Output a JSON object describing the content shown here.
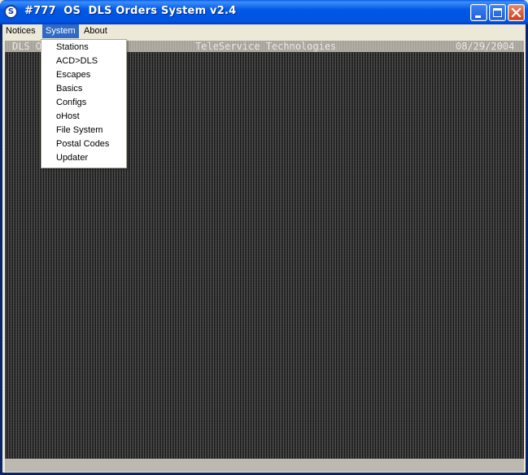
{
  "window": {
    "title": "#777  OS  DLS Orders System v2.4",
    "app_icon_letter": "S",
    "buttons": {
      "minimize": "minimize-icon",
      "maximize": "maximize-icon",
      "close": "close-icon"
    }
  },
  "menubar": {
    "items": [
      {
        "label": "Notices"
      },
      {
        "label": "System"
      },
      {
        "label": "About"
      }
    ],
    "active": "System"
  },
  "console": {
    "header_left": "DLS O",
    "header_center": "TeleService Technologies",
    "header_right": "08/29/2004"
  },
  "system_menu": {
    "items": [
      {
        "label": "Stations"
      },
      {
        "label": "ACD>DLS"
      },
      {
        "label": "Escapes"
      },
      {
        "label": "Basics"
      },
      {
        "label": "Configs"
      },
      {
        "label": "oHost"
      },
      {
        "label": "File System"
      },
      {
        "label": "Postal Codes"
      },
      {
        "label": "Updater"
      }
    ]
  },
  "colors": {
    "titlebar": "#0054E0",
    "menu_highlight": "#316AC5",
    "console_bg": "#000000",
    "close_button": "#C9401B"
  }
}
